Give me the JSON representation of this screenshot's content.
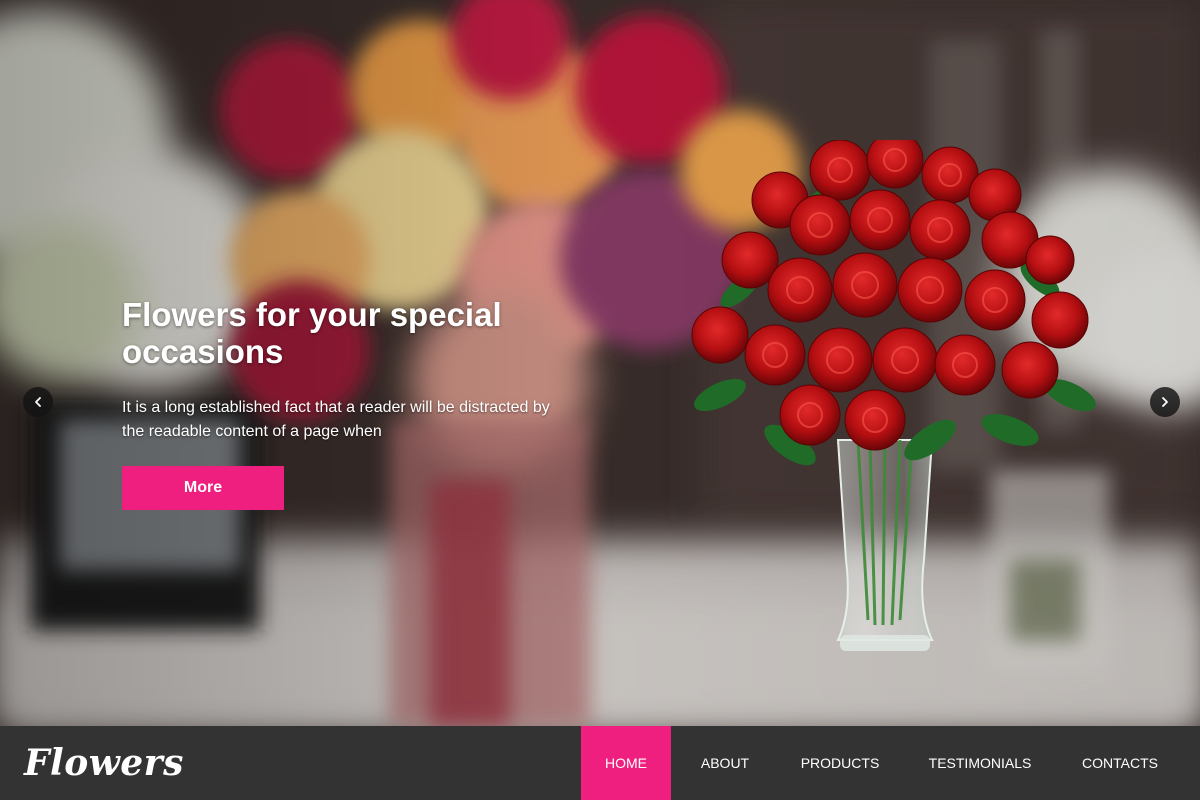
{
  "hero": {
    "title": "Flowers for your special occasions",
    "text": "It is a long established fact that a reader will be distracted by the readable content of a page when",
    "more_label": "More",
    "colors": {
      "accent": "#ee1f7f",
      "text": "#ffffff"
    },
    "prev_icon": "chevron-left-icon",
    "next_icon": "chevron-right-icon"
  },
  "navbar": {
    "logo": "Flowers",
    "background": "#333333",
    "items": [
      {
        "label": "HOME",
        "active": true
      },
      {
        "label": "ABOUT",
        "active": false
      },
      {
        "label": "PRODUCTS",
        "active": false
      },
      {
        "label": "TESTIMONIALS",
        "active": false
      },
      {
        "label": "CONTACTS",
        "active": false
      }
    ]
  }
}
